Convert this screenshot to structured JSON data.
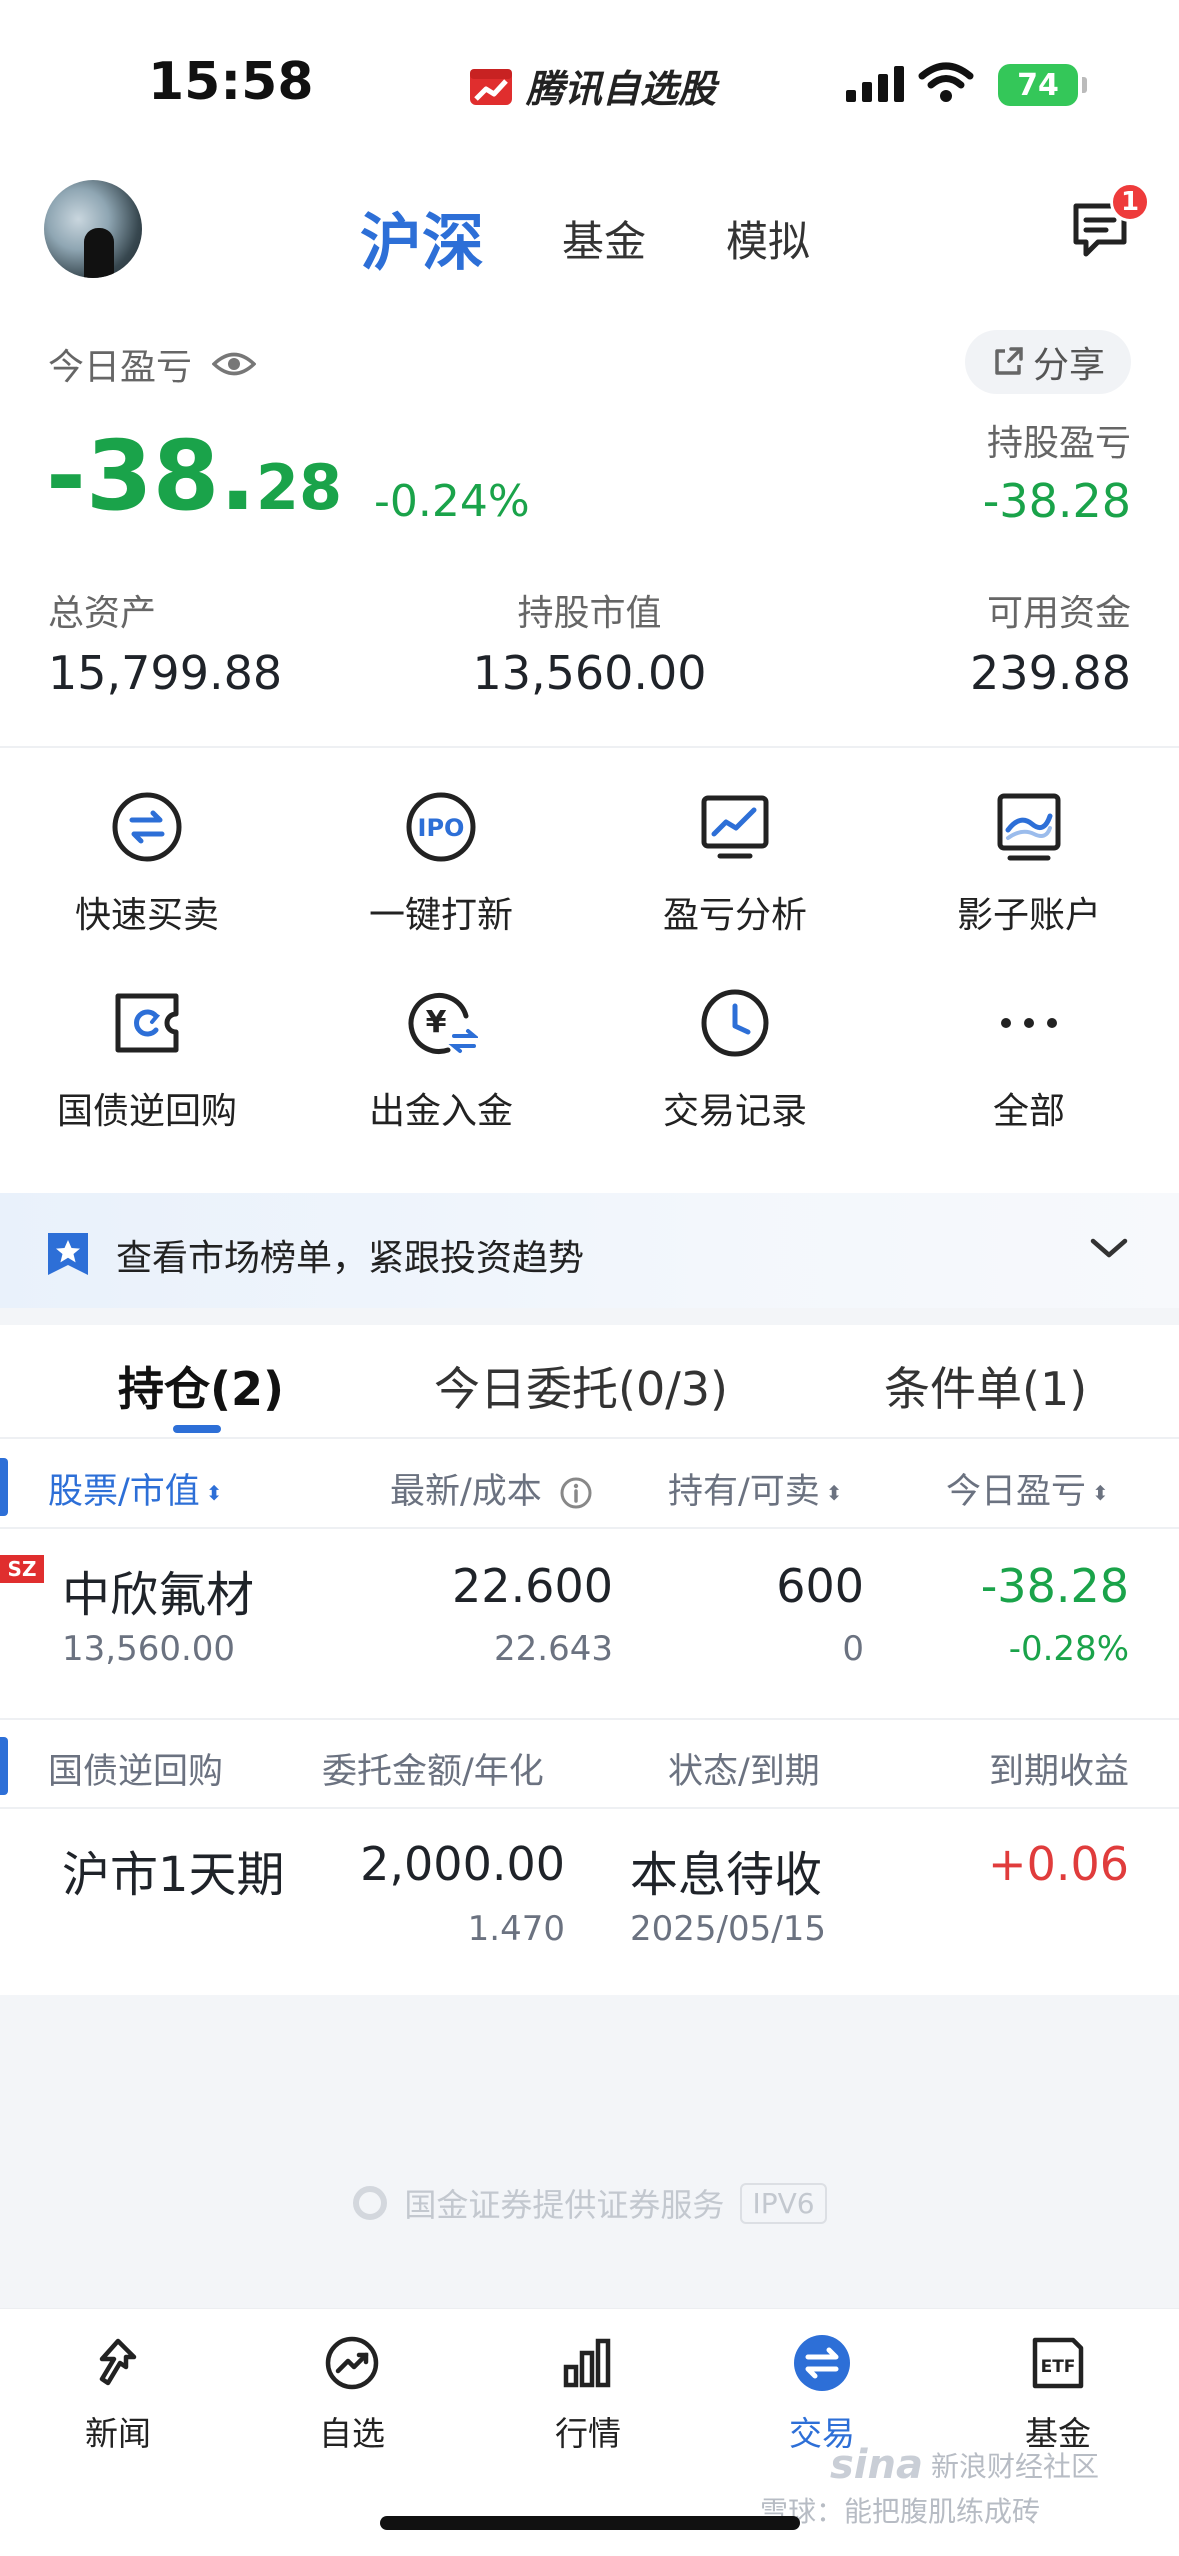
{
  "status": {
    "time": "15:58",
    "app_name": "腾讯自选股",
    "battery": "74"
  },
  "header": {
    "tabs": [
      {
        "label": "沪深",
        "active": true
      },
      {
        "label": "基金",
        "active": false
      },
      {
        "label": "模拟",
        "active": false
      }
    ],
    "message_badge": "1"
  },
  "summary": {
    "today_label": "今日盈亏",
    "share_label": "分享",
    "today_pnl_int": "-38.",
    "today_pnl_dec": "28",
    "today_pnl_pct": "-0.24%",
    "hold_pnl_label": "持股盈亏",
    "hold_pnl_value": "-38.28",
    "total_assets_label": "总资产",
    "total_assets_value": "15,799.88",
    "market_value_label": "持股市值",
    "market_value_value": "13,560.00",
    "available_label": "可用资金",
    "available_value": "239.88"
  },
  "actions": [
    {
      "label": "快速买卖",
      "icon": "swap-icon"
    },
    {
      "label": "一键打新",
      "icon": "ipo-icon",
      "icon_text": "IPO"
    },
    {
      "label": "盈亏分析",
      "icon": "chart-monitor-icon"
    },
    {
      "label": "影子账户",
      "icon": "shadow-account-icon"
    },
    {
      "label": "国债逆回购",
      "icon": "repo-ticket-icon"
    },
    {
      "label": "出金入金",
      "icon": "yuan-transfer-icon",
      "icon_text": "¥"
    },
    {
      "label": "交易记录",
      "icon": "clock-icon"
    },
    {
      "label": "全部",
      "icon": "more-icon"
    }
  ],
  "banner": {
    "text": "查看市场榜单，紧跟投资趋势"
  },
  "positions": {
    "tabs": [
      {
        "label": "持仓(2)",
        "active": true
      },
      {
        "label": "今日委托(0/3)",
        "active": false
      },
      {
        "label": "条件单(1)",
        "active": false
      }
    ],
    "stock_headers": [
      "股票/市值",
      "最新/成本",
      "持有/可卖",
      "今日盈亏"
    ],
    "stock_rows": [
      {
        "market": "SZ",
        "name": "中欣氟材",
        "market_value": "13,560.00",
        "latest": "22.600",
        "cost": "22.643",
        "hold": "600",
        "sellable": "0",
        "pnl": "-38.28",
        "pnl_pct": "-0.28%"
      }
    ],
    "repo_headers": [
      "国债逆回购",
      "委托金额/年化",
      "状态/到期",
      "到期收益"
    ],
    "repo_rows": [
      {
        "name": "沪市1天期",
        "amount": "2,000.00",
        "rate": "1.470",
        "status": "本息待收",
        "due": "2025/05/15",
        "income": "+0.06"
      }
    ]
  },
  "footer": {
    "broker_note": "国金证券提供证券服务",
    "ipv6": "IPV6"
  },
  "tabbar": [
    {
      "label": "新闻",
      "icon": "news-icon",
      "active": false
    },
    {
      "label": "自选",
      "icon": "watchlist-icon",
      "active": false
    },
    {
      "label": "行情",
      "icon": "market-icon",
      "active": false
    },
    {
      "label": "交易",
      "icon": "trade-icon",
      "active": true
    },
    {
      "label": "基金",
      "icon": "etf-icon",
      "icon_text": "ETF",
      "active": false
    }
  ],
  "watermark": {
    "brand": "sina",
    "community": "新浪财经社区",
    "author": "雪球：能把腹肌练成砖"
  },
  "colors": {
    "accent": "#2d6fd7",
    "loss": "#1aa34a",
    "gain": "#e03c3c",
    "badge": "#ee3b3b"
  }
}
